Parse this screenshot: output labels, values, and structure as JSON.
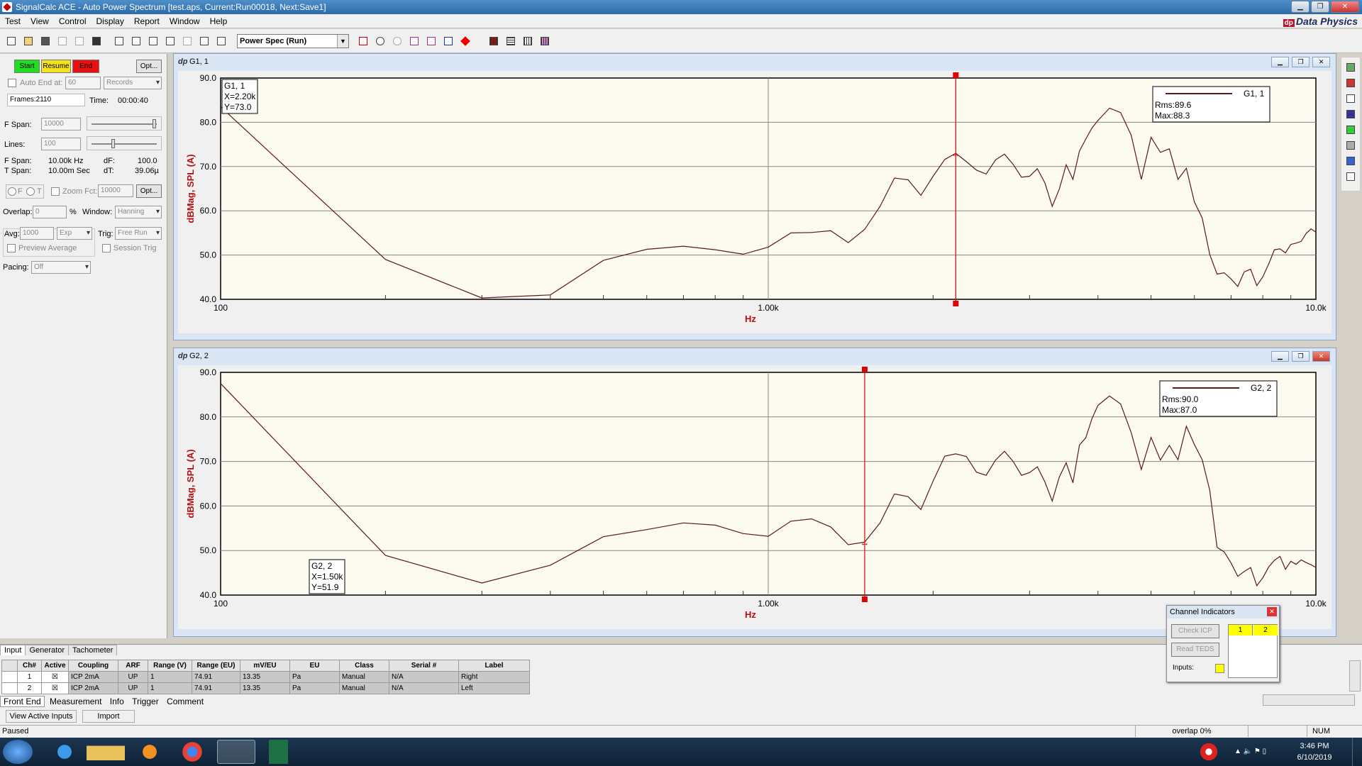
{
  "window": {
    "title": "SignalCalc ACE - Auto Power Spectrum [test.aps, Current:Run00018, Next:Save1]",
    "brand": "Data Physics",
    "brand_logo": "dp"
  },
  "menu": [
    "Test",
    "View",
    "Control",
    "Display",
    "Report",
    "Window",
    "Help"
  ],
  "toolbar": {
    "mode_combo": "Power Spec (Run)"
  },
  "control_panel": {
    "start": "Start",
    "resume": "Resume",
    "end": "End",
    "opt1": "Opt...",
    "auto_end_label": "Auto End at:",
    "auto_end_value": "60",
    "auto_end_unit": "Records",
    "frames": "Frames:2110",
    "time_label": "Time:",
    "time_value": "00:00:40",
    "fspan_label": "F Span:",
    "fspan_value": "10000",
    "lines_label": "Lines:",
    "lines_value": "100",
    "fspan_readout_label": "F Span:",
    "fspan_readout": "10.00k Hz",
    "df_label": "dF:",
    "df_value": "100.0",
    "tspan_readout_label": "T Span:",
    "tspan_readout": "10.00m Sec",
    "dt_label": "dT:",
    "dt_value": "39.06µ",
    "radio_f": "F",
    "radio_t": "T",
    "zoom_label": "Zoom Fct:",
    "zoom_value": "10000",
    "opt2": "Opt...",
    "overlap_label": "Overlap:",
    "overlap_value": "0",
    "overlap_unit": "%",
    "window_label": "Window:",
    "window_value": "Hanning",
    "avg_label": "Avg:",
    "avg_value": "1000",
    "avg_type": "Exp",
    "trig_label": "Trig:",
    "trig_value": "Free Run",
    "preview_avg": "Preview Average",
    "session_trig": "Session Trig",
    "pacing_label": "Pacing:",
    "pacing_value": "Off"
  },
  "graph1": {
    "title": "G1, 1",
    "ylabel": "dBMag, SPL (A)",
    "xlabel": "Hz",
    "yticks": [
      "90.0",
      "80.0",
      "70.0",
      "60.0",
      "50.0",
      "40.0"
    ],
    "xticks": [
      "100",
      "1.00k",
      "10.0k"
    ],
    "cursor_box": {
      "name": "G1, 1",
      "x": "X=2.20k",
      "y": "Y=73.0"
    },
    "legend": {
      "name": "G1, 1",
      "rms": "Rms:89.6",
      "max": "Max:88.3"
    },
    "cursor_hz": 2200,
    "cursor_db": 73.0
  },
  "graph2": {
    "title": "G2, 2",
    "ylabel": "dBMag, SPL (A)",
    "xlabel": "Hz",
    "yticks": [
      "90.0",
      "80.0",
      "70.0",
      "60.0",
      "50.0",
      "40.0"
    ],
    "xticks": [
      "100",
      "1.00k",
      "10.0k"
    ],
    "cursor_box": {
      "name": "G2, 2",
      "x": "X=1.50k",
      "y": "Y=51.9"
    },
    "legend": {
      "name": "G2, 2",
      "rms": "Rms:90.0",
      "max": "Max:87.0"
    },
    "cursor_hz": 1500,
    "cursor_db": 51.9
  },
  "chart_data": [
    {
      "type": "line",
      "title": "G1, 1",
      "xlabel": "Hz",
      "ylabel": "dBMag, SPL (A)",
      "xscale": "log",
      "xlim": [
        100,
        10000
      ],
      "ylim": [
        40,
        90
      ],
      "grid": true,
      "legend_position": "top-right",
      "series": [
        {
          "name": "G1, 1",
          "color": "#5a1a1a",
          "x": [
            100,
            200,
            300,
            400,
            500,
            600,
            700,
            800,
            900,
            1000,
            1100,
            1200,
            1300,
            1400,
            1500,
            1600,
            1700,
            1800,
            1900,
            2000,
            2100,
            2200,
            2300,
            2400,
            2500,
            2600,
            2700,
            2800,
            2900,
            3000,
            3100,
            3200,
            3300,
            3400,
            3500,
            3600,
            3700,
            3800,
            3900,
            4000,
            4200,
            4400,
            4600,
            4800,
            5000,
            5200,
            5400,
            5600,
            5800,
            6000,
            6200,
            6400,
            6600,
            6800,
            7000,
            7200,
            7400,
            7600,
            7800,
            8000,
            8200,
            8400,
            8600,
            8800,
            9000,
            9200,
            9400,
            9600,
            9800,
            10000
          ],
          "y": [
            83.5,
            49.0,
            40.3,
            41.0,
            48.8,
            51.3,
            52.0,
            51.2,
            50.2,
            51.8,
            55.0,
            55.1,
            55.5,
            52.8,
            55.8,
            61.0,
            67.4,
            67.0,
            63.5,
            67.8,
            71.6,
            73.0,
            71.1,
            69.2,
            68.3,
            71.5,
            72.8,
            70.5,
            67.6,
            67.8,
            69.5,
            66.3,
            61.0,
            64.9,
            70.4,
            67.1,
            73.5,
            76.2,
            78.7,
            80.4,
            83.2,
            82.2,
            77.1,
            67.1,
            76.6,
            73.2,
            74.0,
            67.1,
            69.6,
            62.0,
            58.4,
            50.1,
            45.7,
            46.0,
            44.6,
            42.9,
            46.2,
            46.8,
            43.1,
            45.1,
            48.0,
            51.2,
            51.4,
            50.5,
            52.4,
            52.7,
            53.1,
            54.9,
            55.9,
            55.2
          ]
        }
      ]
    },
    {
      "type": "line",
      "title": "G2, 2",
      "xlabel": "Hz",
      "ylabel": "dBMag, SPL (A)",
      "xscale": "log",
      "xlim": [
        100,
        10000
      ],
      "ylim": [
        40,
        90
      ],
      "grid": true,
      "legend_position": "top-right",
      "series": [
        {
          "name": "G2, 2",
          "color": "#5a1a1a",
          "x": [
            100,
            200,
            300,
            400,
            500,
            600,
            700,
            800,
            900,
            1000,
            1100,
            1200,
            1300,
            1400,
            1500,
            1600,
            1700,
            1800,
            1900,
            2000,
            2100,
            2200,
            2300,
            2400,
            2500,
            2600,
            2700,
            2800,
            2900,
            3000,
            3100,
            3200,
            3300,
            3400,
            3500,
            3600,
            3700,
            3800,
            3900,
            4000,
            4200,
            4400,
            4600,
            4800,
            5000,
            5200,
            5400,
            5600,
            5800,
            6000,
            6200,
            6400,
            6600,
            6800,
            7000,
            7200,
            7400,
            7600,
            7800,
            8000,
            8200,
            8400,
            8600,
            8800,
            9000,
            9200,
            9400,
            9600,
            9800,
            10000
          ],
          "y": [
            87.5,
            48.9,
            42.7,
            46.7,
            53.1,
            54.7,
            56.2,
            55.7,
            53.8,
            53.2,
            56.6,
            57.1,
            55.3,
            51.3,
            51.9,
            56.2,
            62.7,
            62.1,
            59.2,
            65.6,
            71.2,
            71.7,
            71.1,
            67.6,
            66.9,
            70.3,
            72.3,
            70.0,
            66.9,
            67.5,
            68.8,
            65.4,
            61.1,
            66.5,
            69.7,
            65.2,
            73.7,
            75.3,
            79.6,
            82.6,
            84.7,
            82.9,
            76.5,
            68.2,
            75.4,
            70.3,
            73.6,
            70.4,
            77.9,
            73.8,
            70.4,
            63.5,
            50.7,
            49.7,
            47.2,
            44.2,
            45.3,
            46.2,
            42.1,
            43.9,
            46.3,
            47.8,
            48.7,
            45.8,
            47.6,
            46.9,
            47.9,
            47.3,
            46.8,
            46.2
          ]
        }
      ]
    }
  ],
  "channel_indicators": {
    "title": "Channel Indicators",
    "check_icp": "Check ICP",
    "read_teds": "Read TEDS",
    "inputs_label": "Inputs:",
    "ch1": "1",
    "ch2": "2"
  },
  "bottom": {
    "tabs": [
      "Input",
      "Generator",
      "Tachometer"
    ],
    "columns": [
      "Ch#",
      "Active",
      "Coupling",
      "ARF",
      "Range (V)",
      "Range (EU)",
      "mV/EU",
      "EU",
      "Class",
      "Serial #",
      "Label"
    ],
    "rows": [
      [
        "1",
        "☒",
        "ICP 2mA",
        "UP",
        "1",
        "74.91",
        "13.35",
        "Pa",
        "Manual",
        "N/A",
        "Right"
      ],
      [
        "2",
        "☒",
        "ICP 2mA",
        "UP",
        "1",
        "74.91",
        "13.35",
        "Pa",
        "Manual",
        "N/A",
        "Left"
      ]
    ],
    "subtabs": [
      "Front End",
      "Measurement",
      "Info",
      "Trigger",
      "Comment"
    ],
    "view_active": "View Active Inputs",
    "import": "Import"
  },
  "status": {
    "left": "Paused",
    "overlap": "overlap 0%",
    "num": "NUM"
  },
  "taskbar": {
    "time": "3:46 PM",
    "date": "6/10/2019"
  }
}
